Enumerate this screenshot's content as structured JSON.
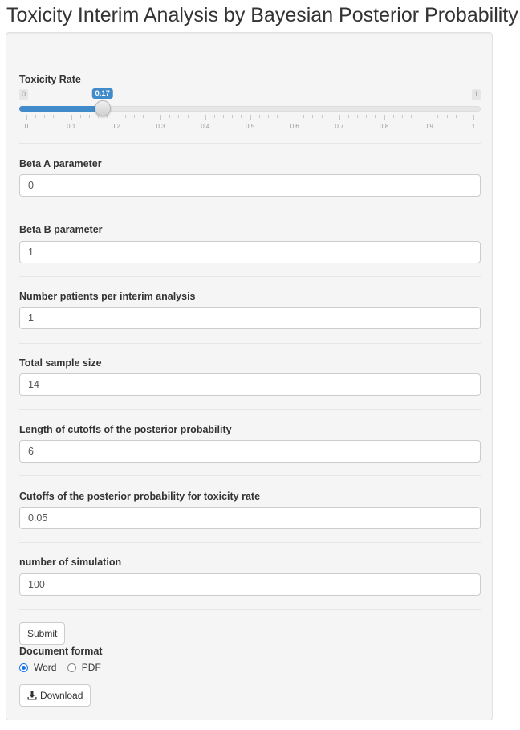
{
  "page": {
    "title": "Toxicity Interim Analysis by Bayesian Posterior Probability"
  },
  "slider": {
    "label": "Toxicity Rate",
    "min": 0,
    "max": 1,
    "value": 0.17,
    "min_label": "0",
    "max_label": "1",
    "value_label": "0.17",
    "tick_labels": [
      "0",
      "0.1",
      "0.2",
      "0.3",
      "0.4",
      "0.5",
      "0.6",
      "0.7",
      "0.8",
      "0.9",
      "1"
    ],
    "accent": "#428bca"
  },
  "fields": [
    {
      "label": "Beta A parameter",
      "value": "0"
    },
    {
      "label": "Beta B parameter",
      "value": "1"
    },
    {
      "label": "Number patients per interim analysis",
      "value": "1"
    },
    {
      "label": "Total sample size",
      "value": "14"
    },
    {
      "label": "Length of cutoffs of the posterior probability",
      "value": "6"
    },
    {
      "label": "Cutoffs of the posterior probability for toxicity rate",
      "value": "0.05"
    },
    {
      "label": "number of simulation",
      "value": "100"
    }
  ],
  "submit": {
    "label": "Submit"
  },
  "document_format": {
    "label": "Document format",
    "options": [
      "Word",
      "PDF"
    ],
    "selected": "Word"
  },
  "download": {
    "label": "Download",
    "icon": "download-icon"
  }
}
